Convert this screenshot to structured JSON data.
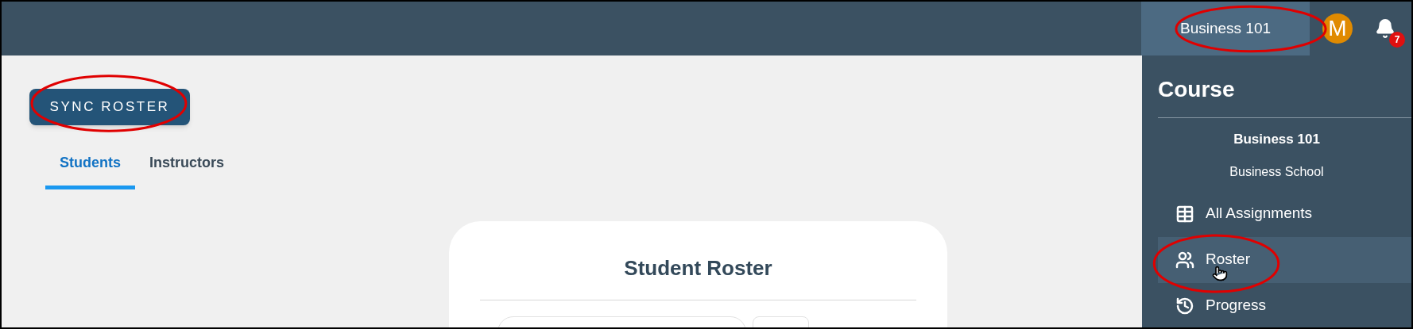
{
  "header": {
    "course_button": "Business 101",
    "avatar": "M",
    "notifications": "7"
  },
  "sync_button": "SYNC ROSTER",
  "tabs": [
    {
      "label": "Students",
      "selected": true
    },
    {
      "label": "Instructors",
      "selected": false
    }
  ],
  "card": {
    "title": "Student Roster"
  },
  "sidebar": {
    "heading": "Course",
    "course_name": "Business 101",
    "school": "Business School",
    "items": [
      {
        "label": "All Assignments",
        "kind": "table",
        "selected": false
      },
      {
        "label": "Roster",
        "kind": "people",
        "selected": true
      },
      {
        "label": "Progress",
        "kind": "history",
        "selected": false
      }
    ]
  }
}
